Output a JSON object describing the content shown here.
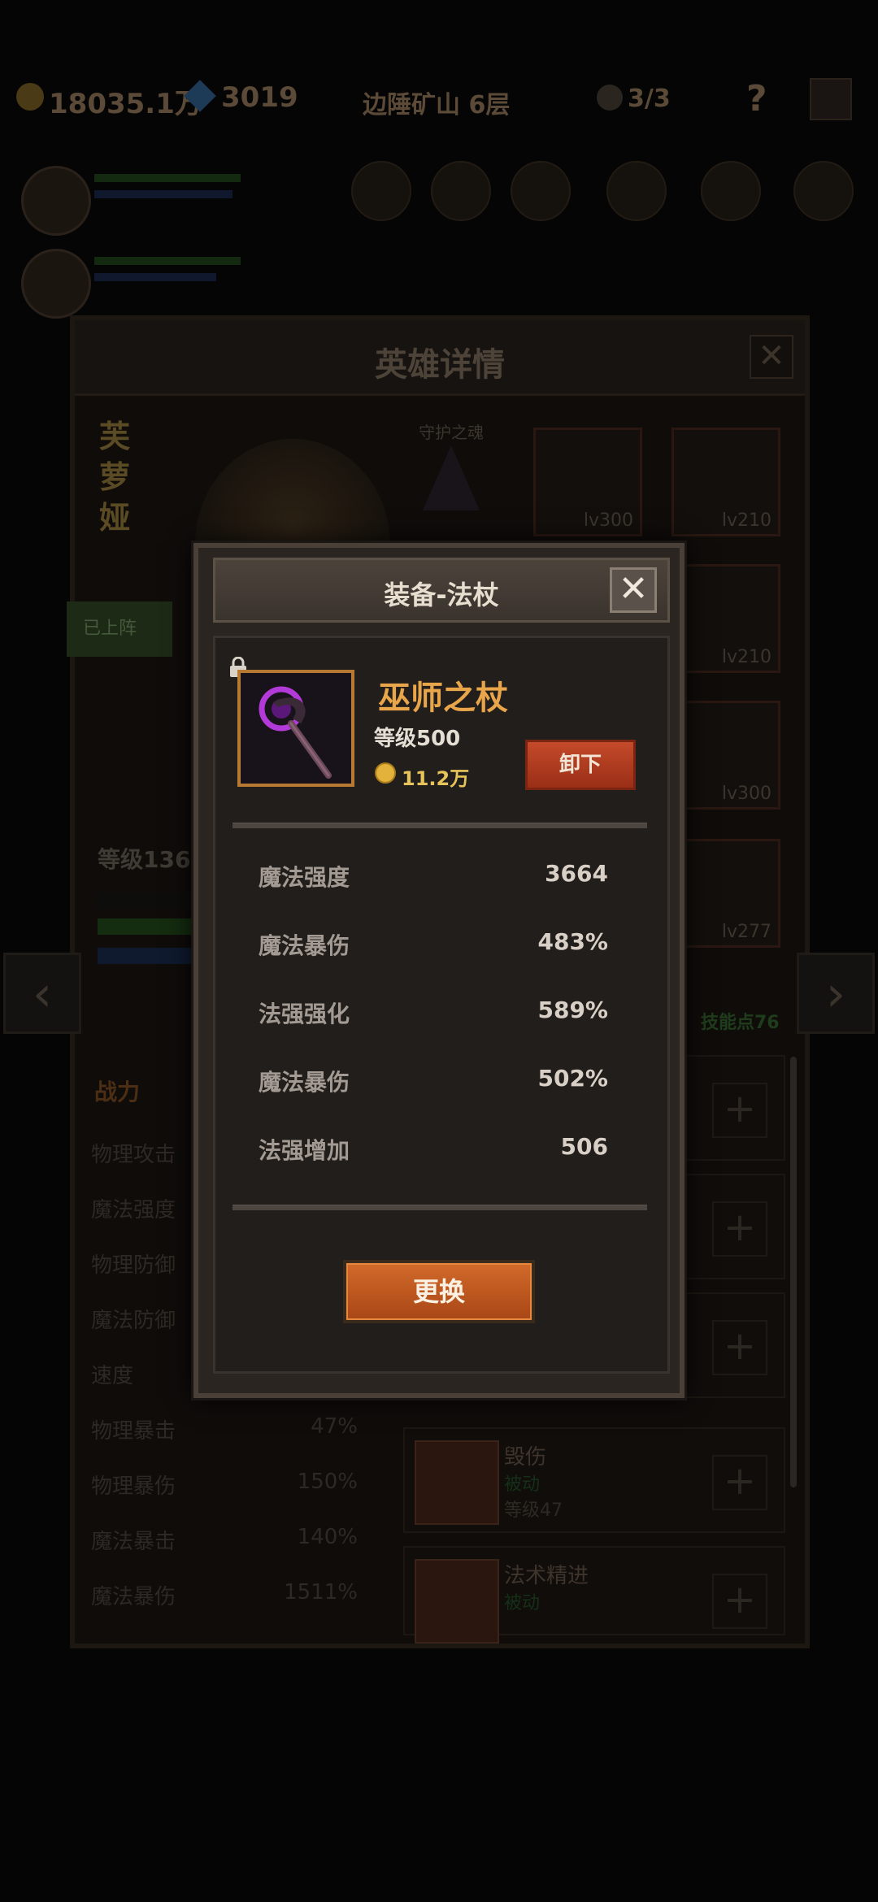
{
  "top_bar": {
    "gold": "18035.1万",
    "gems": "3019",
    "location": "边陲矿山 6层",
    "skull_count": "3/3",
    "help": "?"
  },
  "hero_panel": {
    "title": "英雄详情",
    "close": "✕",
    "hero_name": "芙萝娅",
    "guard_label": "守护之魂",
    "deployed_label": "已上阵",
    "hero_level": "等级136",
    "skill_points": "技能点76",
    "equipment_slots": [
      {
        "level": "lv300"
      },
      {
        "level": "lv210"
      },
      {
        "level": "lv210"
      },
      {
        "level": "lv300"
      },
      {
        "level": "lv277"
      }
    ],
    "stats_tab": "战力",
    "stats": [
      {
        "name": "物理攻击",
        "value": ""
      },
      {
        "name": "魔法强度",
        "value": ""
      },
      {
        "name": "物理防御",
        "value": ""
      },
      {
        "name": "魔法防御",
        "value": ""
      },
      {
        "name": "速度",
        "value": ""
      },
      {
        "name": "物理暴击",
        "value": "47%"
      },
      {
        "name": "物理暴伤",
        "value": "150%"
      },
      {
        "name": "魔法暴击",
        "value": "140%"
      },
      {
        "name": "魔法暴伤",
        "value": "1511%"
      }
    ],
    "skills": [
      {
        "name": "毁伤",
        "type": "被动",
        "level": "等级47"
      },
      {
        "name": "法术精进",
        "type": "被动",
        "level": ""
      }
    ]
  },
  "modal": {
    "title": "装备-法杖",
    "close": "✕",
    "item": {
      "name": "巫师之杖",
      "level": "等级500",
      "price": "11.2万"
    },
    "unequip_label": "卸下",
    "stats": [
      {
        "name": "魔法强度",
        "value": "3664"
      },
      {
        "name": "魔法暴伤",
        "value": "483%"
      },
      {
        "name": "法强强化",
        "value": "589%"
      },
      {
        "name": "魔法暴伤",
        "value": "502%"
      },
      {
        "name": "法强增加",
        "value": "506"
      }
    ],
    "change_label": "更换"
  },
  "colors": {
    "accent_orange": "#e9a54a",
    "button_red": "#c44a2a",
    "button_orange": "#d26a2a",
    "item_border": "#b87a32"
  },
  "icons": {
    "lock": "lock-icon",
    "gold": "gold-coin-icon",
    "gem": "gem-icon",
    "skull": "skull-icon",
    "left_arrow": "chevron-left-icon",
    "right_arrow": "chevron-right-icon",
    "staff": "staff-icon"
  }
}
